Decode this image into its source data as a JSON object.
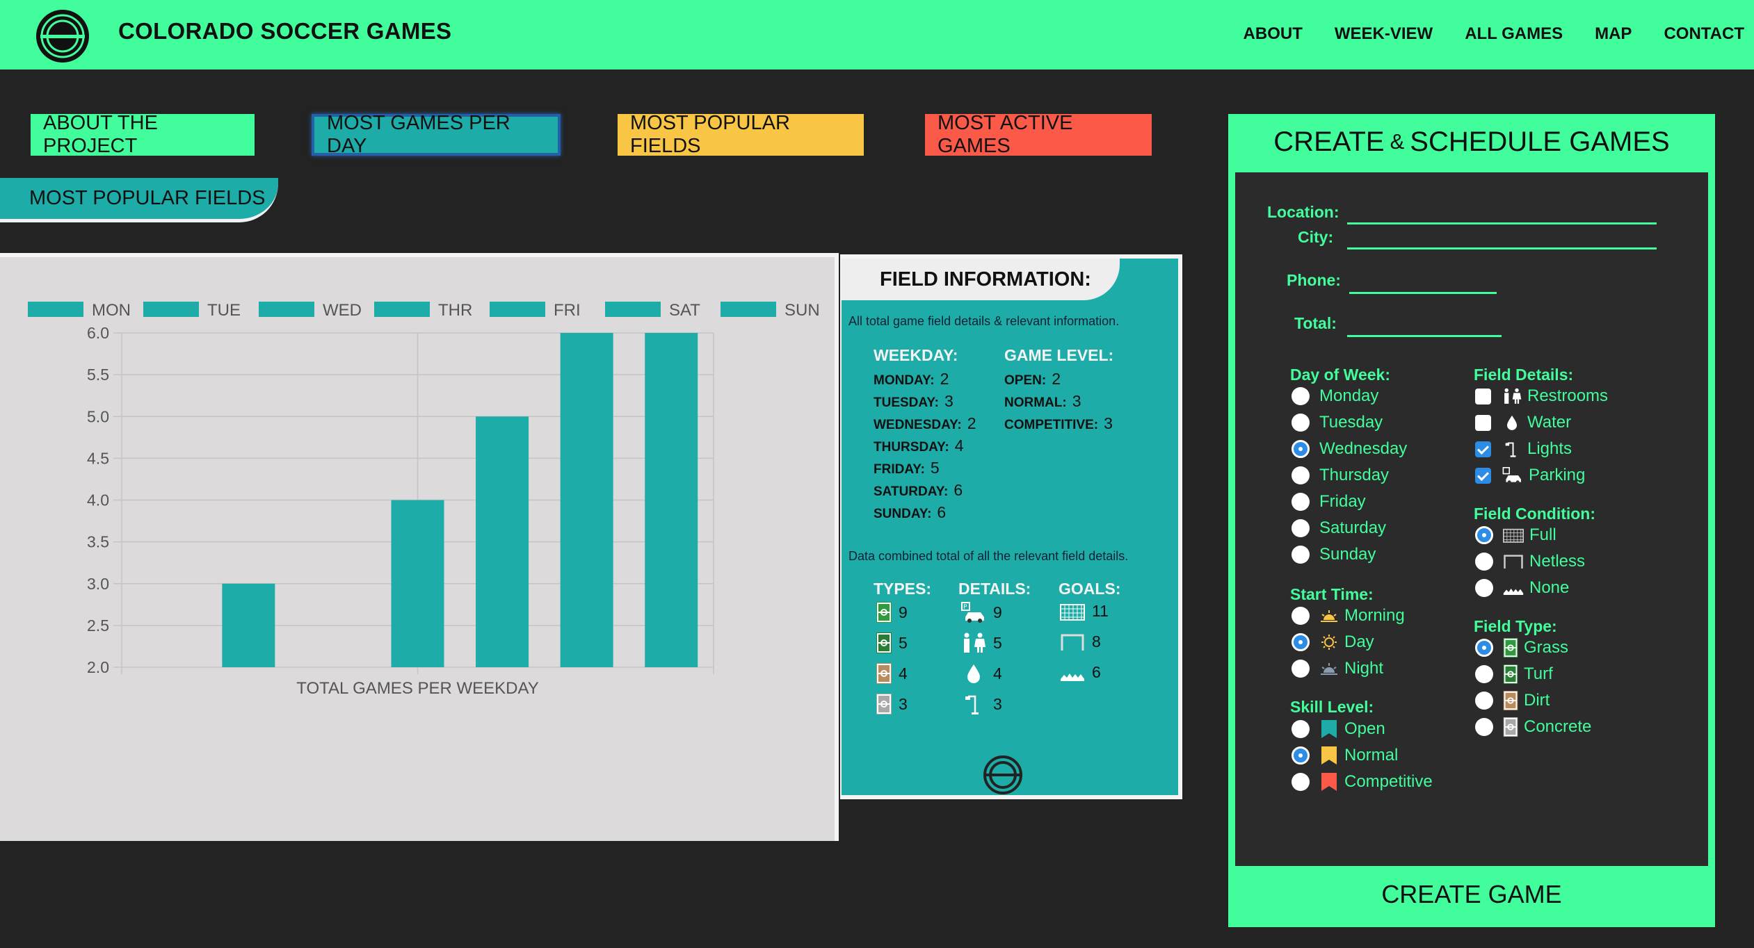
{
  "header": {
    "brand": "COLORADO SOCCER GAMES",
    "nav": [
      "ABOUT",
      "WEEK-VIEW",
      "ALL GAMES",
      "MAP",
      "CONTACT"
    ]
  },
  "selectors": {
    "about": "ABOUT THE PROJECT",
    "per_day": "MOST GAMES PER DAY",
    "fields": "MOST POPULAR FIELDS",
    "active": "MOST ACTIVE GAMES"
  },
  "section_title": "MOST POPULAR FIELDS",
  "colors": {
    "accent_green": "#42fd9b",
    "teal": "#1eaca8",
    "yellow": "#f8c545",
    "red": "#fa5a47",
    "dark_bg": "#232323"
  },
  "chart_data": {
    "type": "bar",
    "legend": [
      "MON",
      "TUE",
      "WED",
      "THR",
      "FRI",
      "SAT",
      "SUN"
    ],
    "categories": [
      "MON",
      "TUE",
      "WED",
      "THR",
      "FRI",
      "SAT",
      "SUN"
    ],
    "values": [
      null,
      3,
      null,
      4,
      5,
      6,
      6
    ],
    "ylim": [
      2.0,
      6.0
    ],
    "yticks": [
      "2.0",
      "2.5",
      "3.0",
      "3.5",
      "4.0",
      "4.5",
      "5.0",
      "5.5",
      "6.0"
    ],
    "xlabel": "TOTAL GAMES PER WEEKDAY",
    "ylabel": "",
    "grid": true,
    "legend_position": "top",
    "bar_color": "#1eaca8"
  },
  "field_info": {
    "title": "FIELD INFORMATION:",
    "intro": "All total game field details & relevant information.",
    "weekday_title": "WEEKDAY:",
    "weekdays": [
      {
        "label": "MONDAY:",
        "value": "2"
      },
      {
        "label": "TUESDAY:",
        "value": "3"
      },
      {
        "label": "WEDNESDAY:",
        "value": "2"
      },
      {
        "label": "THURSDAY:",
        "value": "4"
      },
      {
        "label": "FRIDAY:",
        "value": "5"
      },
      {
        "label": "SATURDAY:",
        "value": "6"
      },
      {
        "label": "SUNDAY:",
        "value": "6"
      }
    ],
    "level_title": "GAME LEVEL:",
    "levels": [
      {
        "label": "OPEN:",
        "value": "2"
      },
      {
        "label": "NORMAL:",
        "value": "3"
      },
      {
        "label": "COMPETITIVE:",
        "value": "3"
      }
    ],
    "combined_note": "Data combined total of all the relevant field details.",
    "types_title": "TYPES:",
    "types": [
      {
        "icon": "grass-field-icon",
        "value": "9"
      },
      {
        "icon": "turf-field-icon",
        "value": "5"
      },
      {
        "icon": "dirt-field-icon",
        "value": "4"
      },
      {
        "icon": "concrete-field-icon",
        "value": "3"
      }
    ],
    "details_title": "DETAILS:",
    "details": [
      {
        "icon": "parking-icon",
        "value": "9"
      },
      {
        "icon": "restrooms-icon",
        "value": "5"
      },
      {
        "icon": "water-icon",
        "value": "4"
      },
      {
        "icon": "lights-icon",
        "value": "3"
      }
    ],
    "goals_title": "GOALS:",
    "goals": [
      {
        "icon": "full-goal-icon",
        "value": "11"
      },
      {
        "icon": "netless-goal-icon",
        "value": "8"
      },
      {
        "icon": "no-goal-icon",
        "value": "6"
      }
    ]
  },
  "create_form": {
    "title_part1": "CREATE",
    "title_amp": "&",
    "title_part2": "SCHEDULE GAMES",
    "location_label": "Location:",
    "city_label": "City:",
    "phone_label": "Phone:",
    "total_label": "Total:",
    "day_title": "Day of Week:",
    "days": [
      "Monday",
      "Tuesday",
      "Wednesday",
      "Thursday",
      "Friday",
      "Saturday",
      "Sunday"
    ],
    "day_selected": "Wednesday",
    "start_title": "Start Time:",
    "start_times": [
      "Morning",
      "Day",
      "Night"
    ],
    "start_selected": "Day",
    "skill_title": "Skill Level:",
    "skills": [
      "Open",
      "Normal",
      "Competitive"
    ],
    "skill_selected": "Normal",
    "details_title": "Field Details:",
    "details": [
      {
        "label": "Restrooms",
        "checked": false
      },
      {
        "label": "Water",
        "checked": false
      },
      {
        "label": "Lights",
        "checked": true
      },
      {
        "label": "Parking",
        "checked": true
      }
    ],
    "condition_title": "Field Condition:",
    "conditions": [
      "Full",
      "Netless",
      "None"
    ],
    "condition_selected": "Full",
    "type_title": "Field Type:",
    "types": [
      "Grass",
      "Turf",
      "Dirt",
      "Concrete"
    ],
    "type_selected": "Grass",
    "submit_label": "CREATE GAME"
  }
}
